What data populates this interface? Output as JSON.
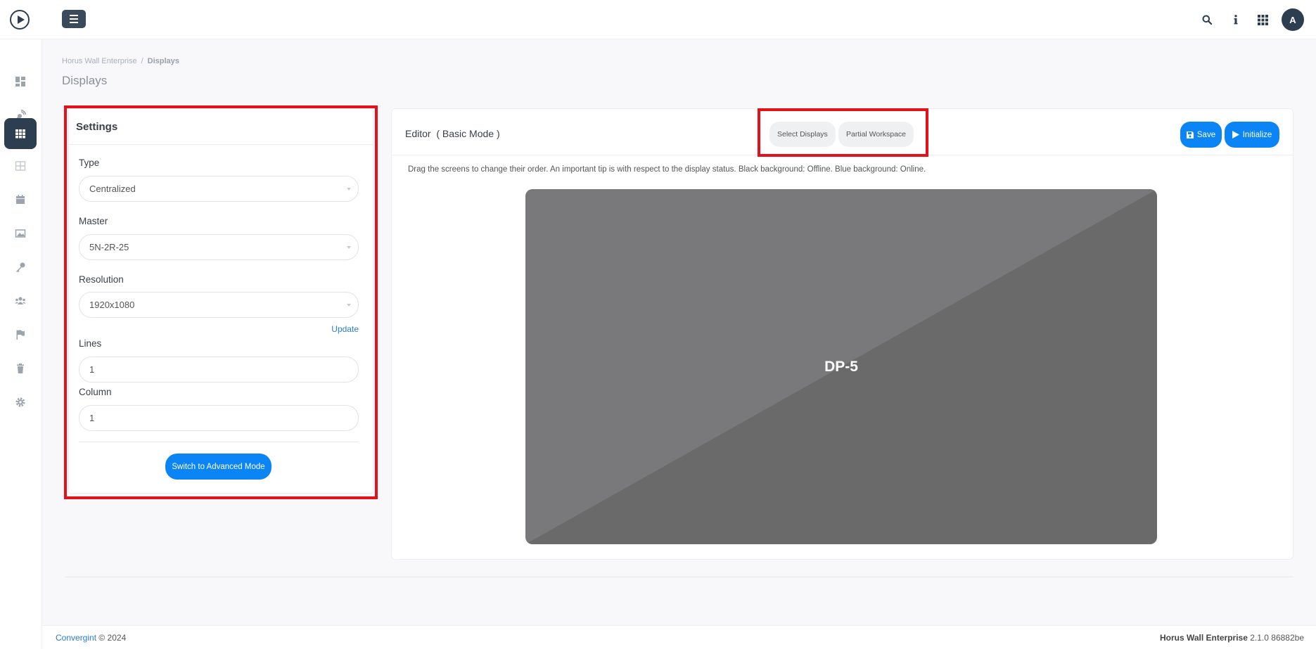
{
  "topbar": {
    "avatar_initial": "A",
    "icons": [
      "search-icon",
      "info-icon",
      "apps-grid-icon"
    ]
  },
  "sidebar": {
    "items": [
      {
        "icon": "dashboard-icon",
        "active": false
      },
      {
        "icon": "satellite-dish-icon",
        "active": false
      },
      {
        "icon": "display-grid-icon",
        "active": true
      },
      {
        "icon": "layout-icon",
        "active": false
      },
      {
        "icon": "calendar-icon",
        "active": false
      },
      {
        "icon": "image-icon",
        "active": false
      },
      {
        "icon": "key-icon",
        "active": false
      },
      {
        "icon": "users-icon",
        "active": false
      },
      {
        "icon": "flag-icon",
        "active": false
      },
      {
        "icon": "trash-icon",
        "active": false
      },
      {
        "icon": "gear-icon",
        "active": false
      }
    ]
  },
  "breadcrumb": {
    "root": "Horus Wall Enterprise",
    "separator": "/",
    "current": "Displays"
  },
  "page": {
    "title": "Displays"
  },
  "settings": {
    "title": "Settings",
    "type_label": "Type",
    "type_value": "Centralized",
    "master_label": "Master",
    "master_value": "5N-2R-25",
    "resolution_label": "Resolution",
    "resolution_value": "1920x1080",
    "update_label": "Update",
    "lines_label": "Lines",
    "lines_value": "1",
    "column_label": "Column",
    "column_value": "1",
    "advanced_button": "Switch to Advanced Mode"
  },
  "editor": {
    "title": "Editor",
    "mode": "( Basic Mode )",
    "select_displays": "Select Displays",
    "partial_workspace": "Partial Workspace",
    "save": "Save",
    "initialize": "Initialize",
    "hint": "Drag the screens to change their order. An important tip is with respect to the display status. Black background: Offline. Blue background: Online.",
    "display_name": "DP-5"
  },
  "footer": {
    "company": "Convergint",
    "copyright": "© 2024",
    "product": "Horus Wall Enterprise",
    "version": "2.1.0 86882be"
  },
  "colors": {
    "primary": "#0b84f5",
    "sidebar_active": "#2d3e50",
    "highlight": "#e4101a",
    "display_tile": "#727273"
  }
}
